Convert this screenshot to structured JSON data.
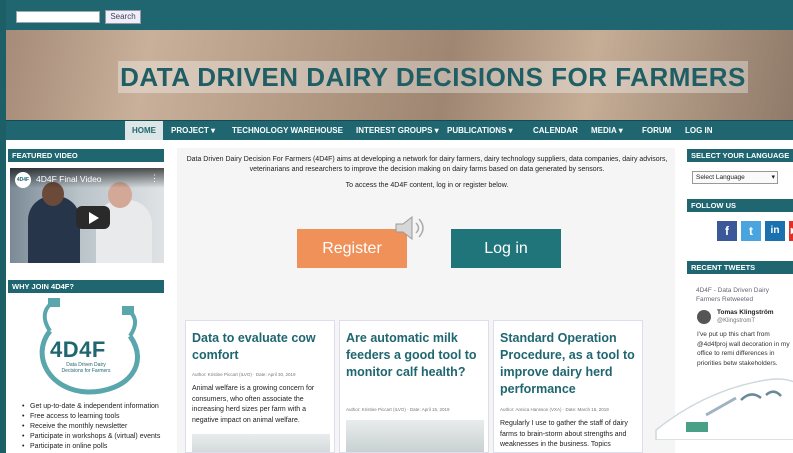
{
  "search": {
    "placeholder": "",
    "button_label": "Search"
  },
  "banner": {
    "title": "DATA DRIVEN DAIRY DECISIONS FOR FARMERS"
  },
  "nav": {
    "items": [
      {
        "label": "HOME",
        "active": true
      },
      {
        "label": "PROJECT ▾"
      },
      {
        "label": "TECHNOLOGY WAREHOUSE"
      },
      {
        "label": "INTEREST GROUPS ▾"
      },
      {
        "label": "PUBLICATIONS ▾"
      },
      {
        "label": "CALENDAR"
      },
      {
        "label": "MEDIA ▾"
      },
      {
        "label": "FORUM"
      },
      {
        "label": "LOG IN"
      }
    ]
  },
  "left": {
    "featured_video_heading": "FEATURED VIDEO",
    "video_title": "4D4F Final Video",
    "video_logo": "4D4F",
    "why_heading": "WHY JOIN 4D4F?",
    "logo_text": "4D4F",
    "logo_subtitle": "Data Driven Dairy Decisions for Farmers",
    "why_items": [
      "Get up-to-date & independent information",
      "Free access to learning tools",
      "Receive the monthly newsletter",
      "Participate in workshops & (virtual) events",
      "Participate in online polls"
    ]
  },
  "main": {
    "intro": "Data Driven Dairy Decision For Farmers (4D4F) aims at developing a network for dairy farmers, dairy technology suppliers, data companies, dairy advisors, veterinarians and researchers to improve the decision making on dairy farms based on data generated by sensors.",
    "access_text": "To access the 4D4F content, log in or register below.",
    "register_label": "Register",
    "login_label": "Log in",
    "cards": [
      {
        "title": "Data to evaluate cow comfort",
        "meta": "Author: Kristine Piccart (ILVO) · Date: April 30, 2019",
        "body": "Animal welfare is a growing concern for consumers, who often associate the increasing herd sizes per farm with a negative impact on animal welfare."
      },
      {
        "title": "Are automatic milk feeders a good tool to monitor calf health?",
        "meta": "Author: Kristine Piccart (ILVO) · Date: April 15, 2019",
        "body": ""
      },
      {
        "title": "Standard Operation Procedure, as a tool to improve dairy herd performance",
        "meta": "Author: Annica Hansson (VXA) · Date: March 15, 2019",
        "body": "Regularly I use to gather the staff of dairy farms to brain-storm about strengths and weaknesses in the business. Topics"
      }
    ]
  },
  "right": {
    "language_heading": "SELECT YOUR LANGUAGE",
    "language_select": "Select Language",
    "follow_heading": "FOLLOW US",
    "social": [
      {
        "icon": "facebook-icon",
        "glyph": "f",
        "color": "#3b5998"
      },
      {
        "icon": "twitter-icon",
        "glyph": "t",
        "color": "#4aa4dd"
      },
      {
        "icon": "linkedin-icon",
        "glyph": "in",
        "color": "#1a71ad"
      },
      {
        "icon": "youtube-icon",
        "glyph": "▶",
        "color": "#e52d27"
      }
    ],
    "tweets_heading": "RECENT TWEETS",
    "retweet_line": "4D4F - Data Driven Dairy Farmers Retweeted",
    "tweet_name": "Tomas Klingström",
    "tweet_handle": "@KlingstromT",
    "tweet_text": "I've put up this chart from @4d4fproj wall decoration in my office to remi differences in priorities betw stakeholders."
  }
}
